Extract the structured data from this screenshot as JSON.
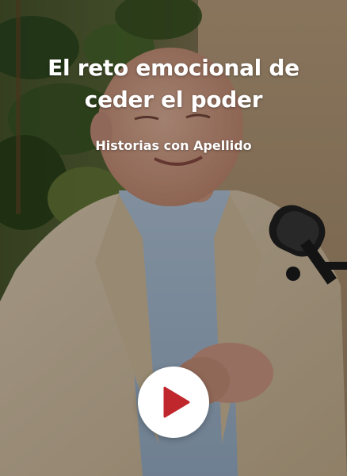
{
  "card": {
    "title": "El reto emocional de ceder el poder",
    "subtitle": "Historias con Apellido"
  },
  "thumbnail": {
    "subject": "podcast-guest-with-microphone"
  },
  "play_button": {
    "icon": "play-icon",
    "color": "#c0272d"
  },
  "colors": {
    "overlay_text": "#ffffff",
    "play_background": "#ffffff",
    "play_icon": "#c0272d"
  }
}
